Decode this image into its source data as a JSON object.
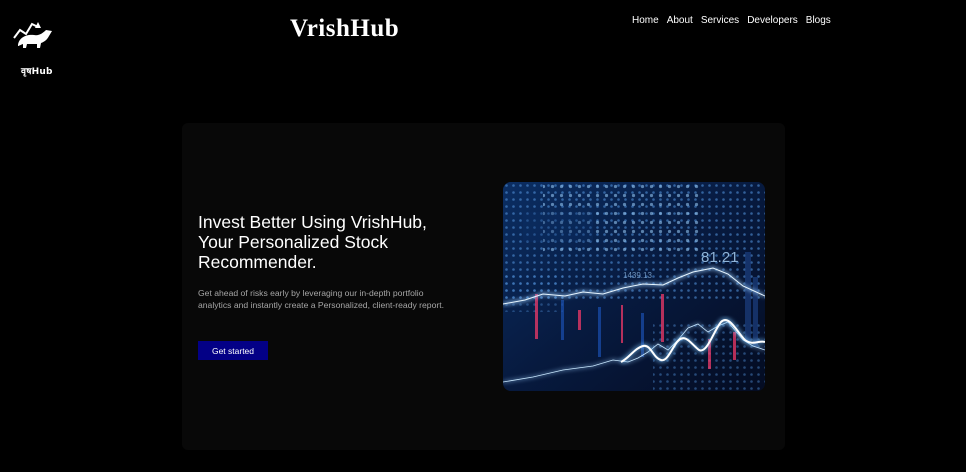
{
  "logo": {
    "text": "वृषHub",
    "icon": "bull-logo-icon"
  },
  "brand": {
    "name": "VrishHub"
  },
  "nav": {
    "items": [
      {
        "label": "Home"
      },
      {
        "label": "About"
      },
      {
        "label": "Services"
      },
      {
        "label": "Developers"
      },
      {
        "label": "Blogs"
      }
    ]
  },
  "hero": {
    "headline": "Invest Better Using VrishHub, Your Personalized Stock Recommender.",
    "description": "Get ahead of risks early by leveraging our in-depth portfolio analytics and instantly create a Personalized, client-ready report.",
    "cta_label": "Get started",
    "image": {
      "icon": "stock-chart-image",
      "value_main": "81.21",
      "value_small": "1439.13"
    }
  },
  "colors": {
    "page_background": "#000000",
    "card_background": "#080808",
    "cta_background": "#030086",
    "image_glow": "#5cc8ff",
    "text_muted": "#a6a6a6"
  }
}
